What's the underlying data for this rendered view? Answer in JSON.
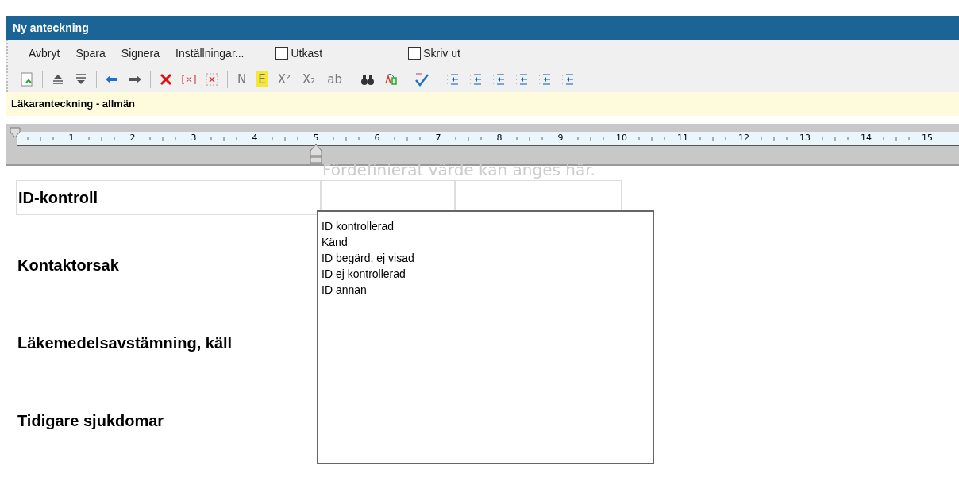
{
  "window": {
    "title": "Ny anteckning"
  },
  "menu": [
    {
      "kind": "link",
      "label": "Avbryt"
    },
    {
      "kind": "link",
      "label": "Spara"
    },
    {
      "kind": "link",
      "label": "Signera"
    },
    {
      "kind": "link",
      "label": "Inställningar..."
    },
    {
      "kind": "checkbox",
      "label": "Utkast",
      "checked": false
    },
    {
      "kind": "checkbox",
      "label": "Skriv ut",
      "checked": false
    }
  ],
  "toolbar": [
    {
      "kind": "icon"
    },
    {
      "kind": "sep"
    },
    {
      "kind": "icon"
    },
    {
      "kind": "icon"
    },
    {
      "kind": "sep"
    },
    {
      "kind": "icon"
    },
    {
      "kind": "icon"
    },
    {
      "kind": "sep"
    },
    {
      "kind": "icon"
    },
    {
      "kind": "icon"
    },
    {
      "kind": "icon"
    },
    {
      "kind": "sep"
    },
    {
      "kind": "text",
      "label": "N",
      "selected": false
    },
    {
      "kind": "text",
      "label": "E",
      "selected": true
    },
    {
      "kind": "text",
      "label": "X²",
      "selected": false
    },
    {
      "kind": "text",
      "label": "X₂",
      "selected": false
    },
    {
      "kind": "text",
      "label": "ab",
      "selected": false
    },
    {
      "kind": "sep"
    },
    {
      "kind": "icon"
    },
    {
      "kind": "icon"
    },
    {
      "kind": "sep"
    },
    {
      "kind": "icon"
    },
    {
      "kind": "sep"
    },
    {
      "kind": "icon"
    },
    {
      "kind": "icon"
    },
    {
      "kind": "icon"
    },
    {
      "kind": "icon"
    },
    {
      "kind": "icon"
    },
    {
      "kind": "icon"
    }
  ],
  "template_bar": {
    "title": "Läkaranteckning - allmän"
  },
  "ruler": {
    "numbers": [
      "1",
      "2",
      "3",
      "4",
      "5",
      "6",
      "7",
      "8",
      "9",
      "10",
      "11",
      "12",
      "13",
      "14",
      "15"
    ]
  },
  "hint": "Fördefinierat värde kan anges här.",
  "sections": [
    "ID-kontroll",
    "Kontaktorsak",
    "Läkemedelsavstämning, käll",
    "Tidigare sjukdomar"
  ],
  "dropdown": {
    "options": [
      "ID kontrollerad",
      "Känd",
      "ID begärd, ej visad",
      "ID ej kontrollerad",
      "ID annan"
    ]
  }
}
